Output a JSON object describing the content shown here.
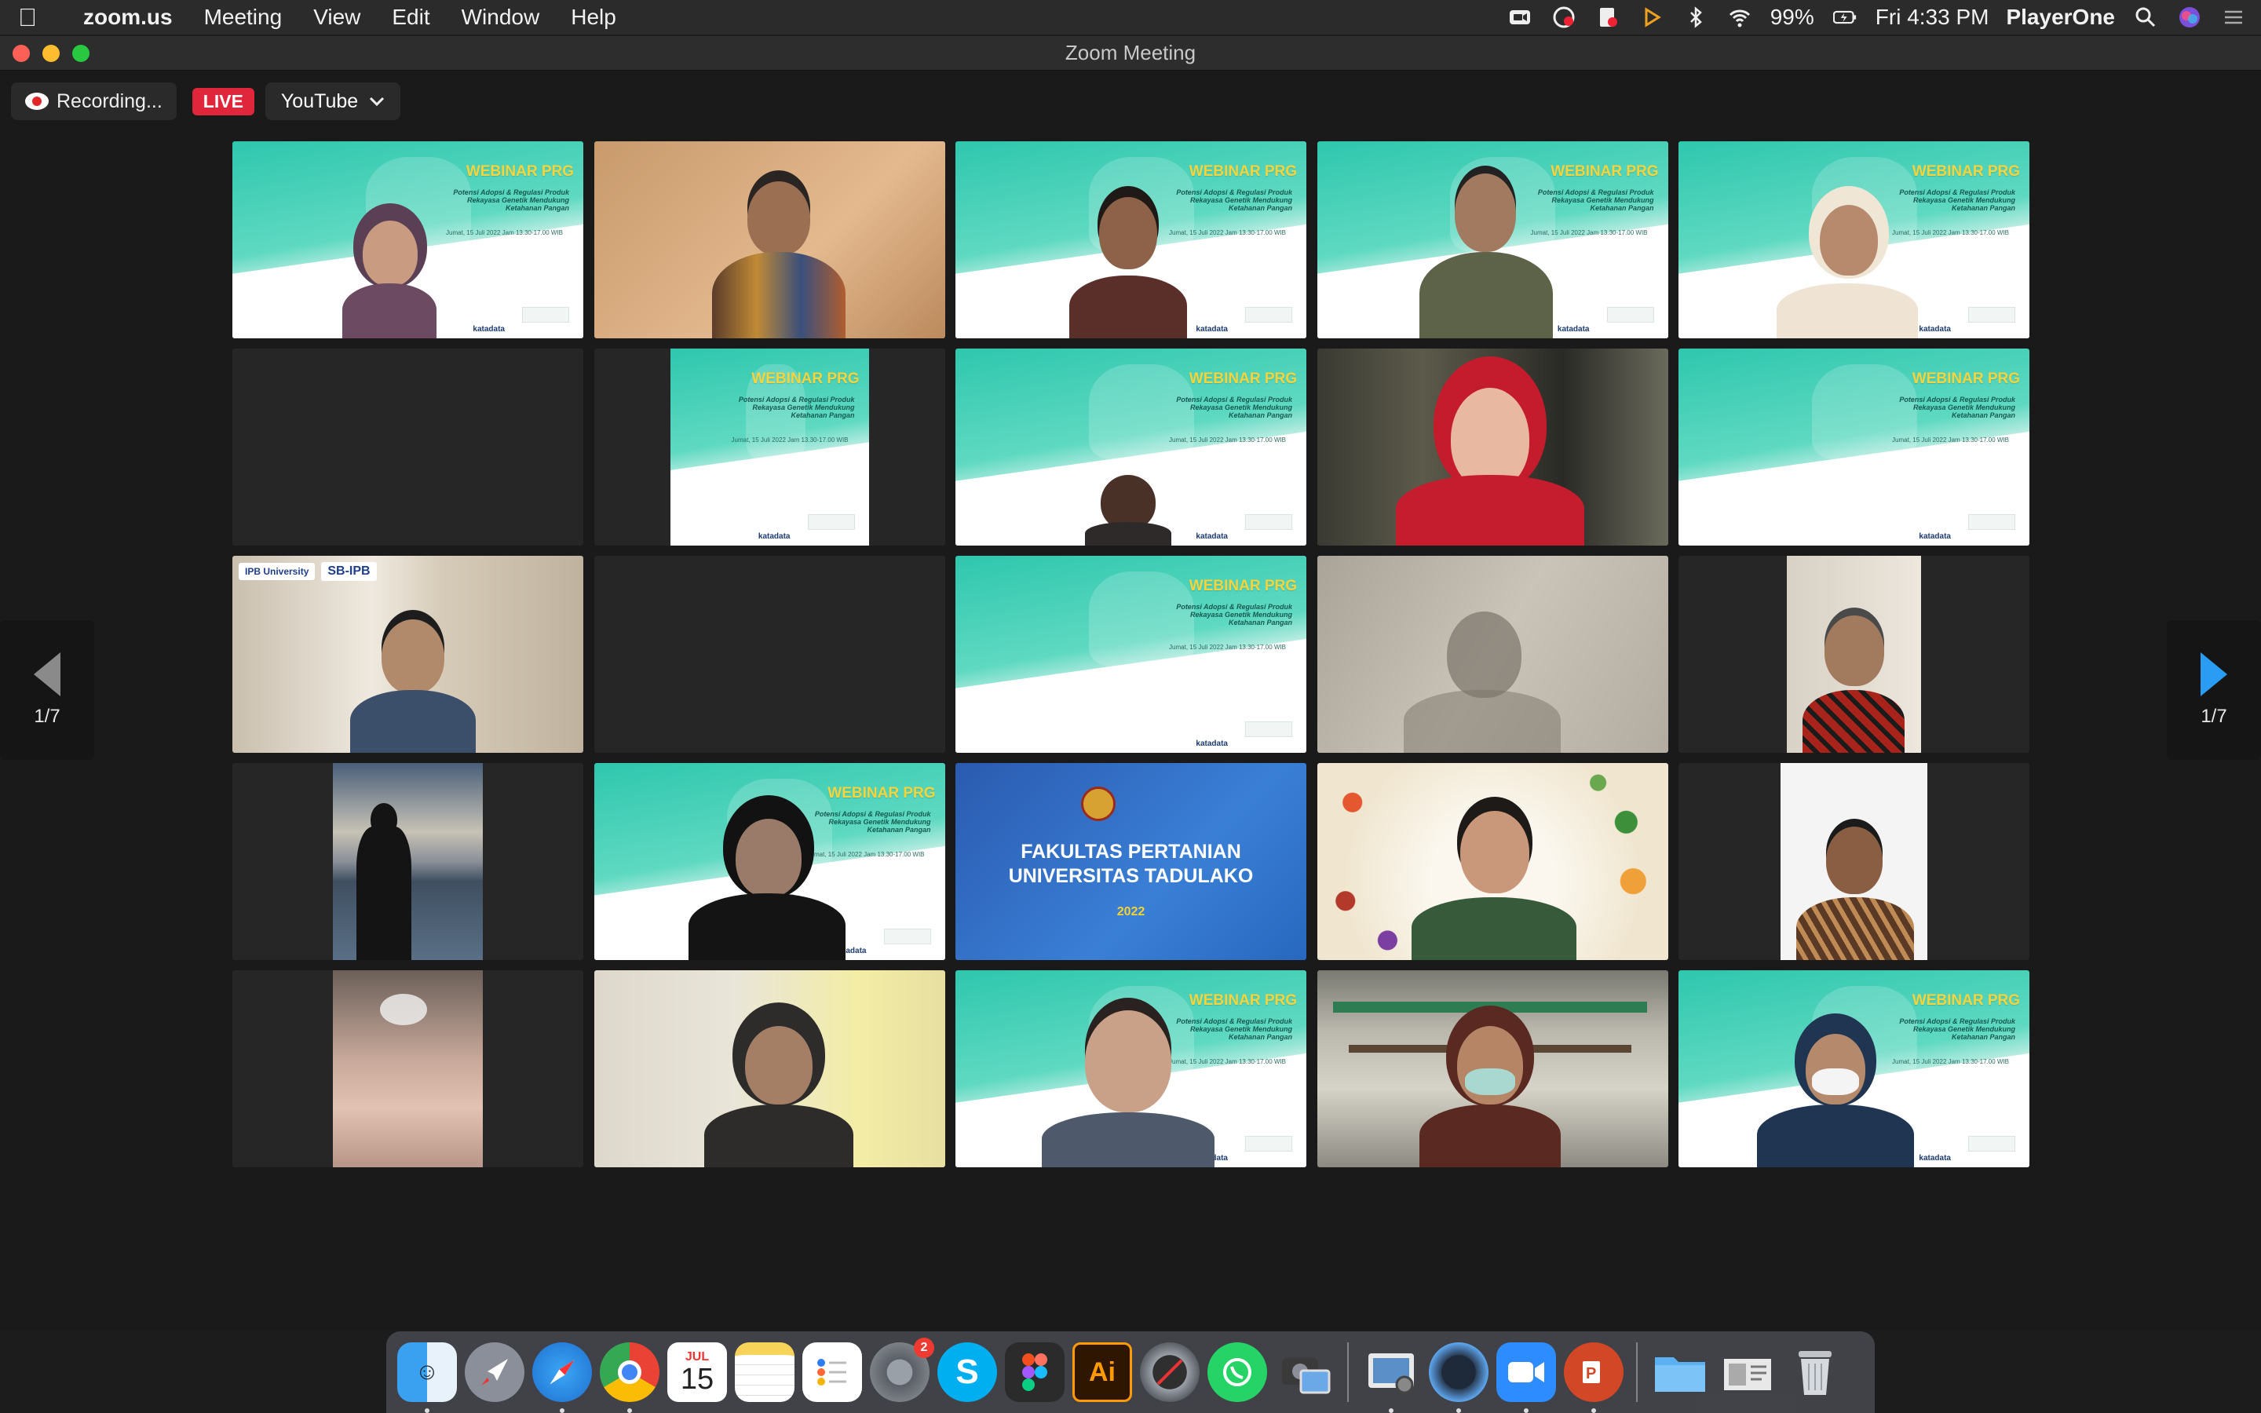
{
  "menubar": {
    "app": "zoom.us",
    "menus": [
      "Meeting",
      "View",
      "Edit",
      "Window",
      "Help"
    ],
    "battery": "99%",
    "clock": "Fri 4:33 PM",
    "user": "PlayerOne"
  },
  "window": {
    "title": "Zoom Meeting"
  },
  "toolbar": {
    "recording": "Recording...",
    "live": "LIVE",
    "stream_target": "YouTube"
  },
  "pager": {
    "left": "1/7",
    "right": "1/7"
  },
  "banner": {
    "title": "WEBINAR PRG",
    "subtitle": "Potensi Adopsi & Regulasi Produk Rekayasa Genetik Mendukung Ketahanan Pangan",
    "date": "Jumat, 15 Juli 2022 Jam 13.30-17.00 WIB",
    "sponsor": "katadata"
  },
  "tiles": {
    "ipb_logo": "SB-IPB",
    "fakultas_line1": "FAKULTAS PERTANIAN",
    "fakultas_line2": "UNIVERSITAS TADULAKO",
    "fakultas_year": "2022"
  },
  "dock": {
    "calendar_month": "JUL",
    "calendar_day": "15",
    "settings_badge": "2",
    "skype": "S",
    "illustrator": "Ai"
  },
  "colors": {
    "accent_live": "#e0263a",
    "active_speaker": "#35d135",
    "nav_arrow": "#2a9cf4"
  }
}
